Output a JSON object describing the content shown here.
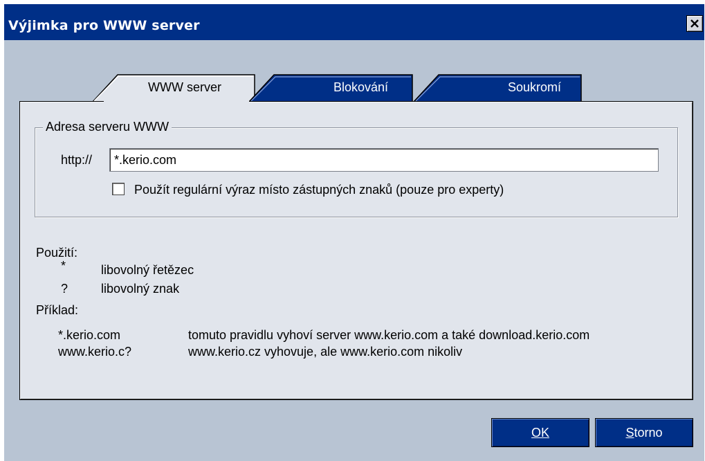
{
  "window": {
    "title": "Výjimka pro WWW server",
    "close_icon": "close-icon",
    "colors": {
      "titlebar": "#002f87",
      "body": "#b8c4d3",
      "panel": "#e1e5ec",
      "button": "#002f87"
    }
  },
  "tabs": [
    {
      "label": "WWW server",
      "active": true
    },
    {
      "label": "Blokování",
      "active": false
    },
    {
      "label": "Soukromí",
      "active": false
    }
  ],
  "group": {
    "legend": "Adresa serveru WWW",
    "url_prefix": "http://",
    "url_value": "*.kerio.com",
    "regex_checkbox_label": "Použít regulární výraz místo zástupných znaků (pouze pro experty)",
    "regex_checked": false
  },
  "help": {
    "usage_title": "Použití:",
    "usage": [
      {
        "symbol": "*",
        "meaning": "libovolný řetězec"
      },
      {
        "symbol": "?",
        "meaning": "libovolný znak"
      }
    ],
    "example_title": "Příklad:",
    "examples": [
      {
        "pattern": "*.kerio.com",
        "description": "tomuto pravidlu vyhoví server www.kerio.com a také download.kerio.com"
      },
      {
        "pattern": "www.kerio.c?",
        "description": "www.kerio.cz vyhovuje, ale www.kerio.com nikoliv"
      }
    ]
  },
  "buttons": {
    "ok_label": "OK",
    "storno_label": "Storno"
  }
}
